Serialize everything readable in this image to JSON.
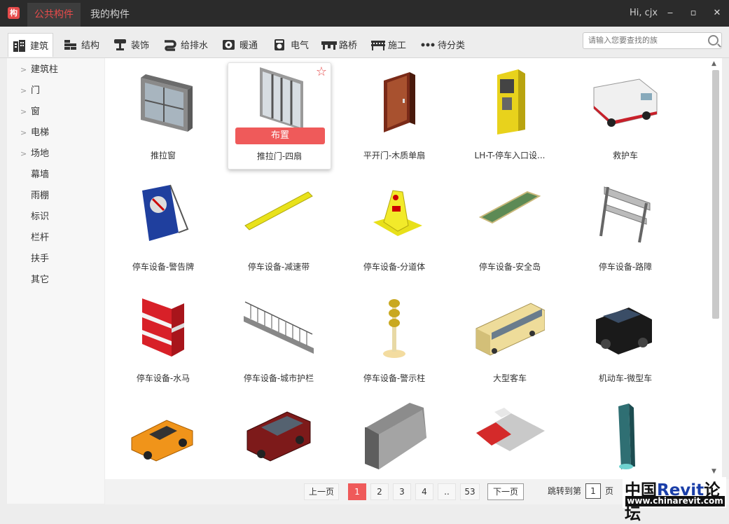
{
  "titlebar": {
    "logo_text": "构",
    "tabs": [
      {
        "label": "公共构件",
        "active": true
      },
      {
        "label": "我的构件",
        "active": false
      }
    ],
    "greeting": "Hi, cjx",
    "minimize": "‒",
    "maximize": "▫",
    "close": "✕"
  },
  "categories": [
    {
      "label": "建筑",
      "icon": "building-icon",
      "active": true
    },
    {
      "label": "结构",
      "icon": "structure-icon",
      "active": false
    },
    {
      "label": "装饰",
      "icon": "decoration-icon",
      "active": false
    },
    {
      "label": "给排水",
      "icon": "plumbing-icon",
      "active": false
    },
    {
      "label": "暖通",
      "icon": "hvac-icon",
      "active": false
    },
    {
      "label": "电气",
      "icon": "electrical-icon",
      "active": false
    },
    {
      "label": "路桥",
      "icon": "bridge-icon",
      "active": false
    },
    {
      "label": "施工",
      "icon": "construction-icon",
      "active": false
    },
    {
      "label": "待分类",
      "icon": "more-icon",
      "active": false
    }
  ],
  "search": {
    "placeholder": "请输入您要查找的族"
  },
  "sidebar": {
    "items": [
      {
        "label": "建筑柱",
        "expandable": true
      },
      {
        "label": "门",
        "expandable": true
      },
      {
        "label": "窗",
        "expandable": true
      },
      {
        "label": "电梯",
        "expandable": true
      },
      {
        "label": "场地",
        "expandable": true
      },
      {
        "label": "幕墙",
        "expandable": false
      },
      {
        "label": "雨棚",
        "expandable": false
      },
      {
        "label": "标识",
        "expandable": false
      },
      {
        "label": "栏杆",
        "expandable": false
      },
      {
        "label": "扶手",
        "expandable": false
      },
      {
        "label": "其它",
        "expandable": false
      }
    ]
  },
  "grid": {
    "place_label": "布置",
    "star_glyph": "☆",
    "items": [
      {
        "name": "推拉窗",
        "thumb": "sliding-window"
      },
      {
        "name": "推拉门-四扇",
        "thumb": "sliding-door",
        "selected": true
      },
      {
        "name": "平开门-木质单扇",
        "thumb": "wood-door"
      },
      {
        "name": "LH-T-停车入口设...",
        "thumb": "parking-kiosk"
      },
      {
        "name": "救护车",
        "thumb": "ambulance"
      },
      {
        "name": "停车设备-警告牌",
        "thumb": "warning-sign"
      },
      {
        "name": "停车设备-减速带",
        "thumb": "speed-bump"
      },
      {
        "name": "停车设备-分道体",
        "thumb": "lane-divider"
      },
      {
        "name": "停车设备-安全岛",
        "thumb": "safety-island"
      },
      {
        "name": "停车设备-路障",
        "thumb": "roadblock"
      },
      {
        "name": "停车设备-水马",
        "thumb": "water-barrier"
      },
      {
        "name": "停车设备-城市护栏",
        "thumb": "city-fence"
      },
      {
        "name": "停车设备-警示柱",
        "thumb": "warning-post"
      },
      {
        "name": "大型客车",
        "thumb": "bus"
      },
      {
        "name": "机动车-微型车",
        "thumb": "mini-car"
      },
      {
        "name": "",
        "thumb": "convertible"
      },
      {
        "name": "",
        "thumb": "suv"
      },
      {
        "name": "",
        "thumb": "concrete-barrier"
      },
      {
        "name": "",
        "thumb": "red-platform"
      },
      {
        "name": "",
        "thumb": "teal-panel"
      }
    ]
  },
  "pager": {
    "prev": "上一页",
    "pages": [
      "1",
      "2",
      "3",
      "4",
      "..",
      "53"
    ],
    "current": "1",
    "next": "下一页",
    "jump_label": "跳转到第",
    "jump_value": "1",
    "page_unit": "页"
  },
  "watermark": {
    "line1_a": "中国",
    "line1_b": "Revit",
    "line1_c": "论坛",
    "line2": "www.chinarevit.com"
  }
}
